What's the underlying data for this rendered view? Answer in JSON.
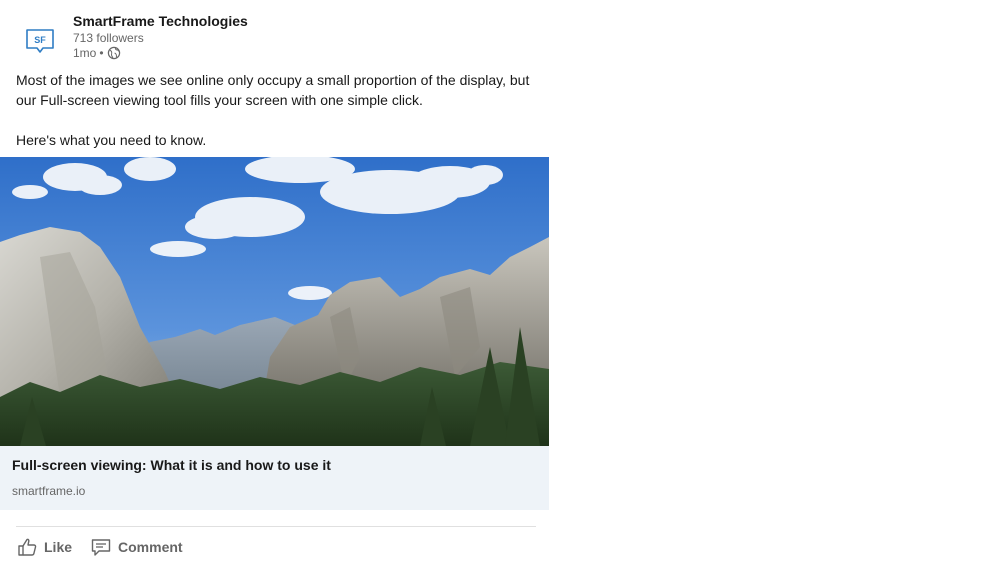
{
  "post": {
    "company": {
      "name": "SmartFrame Technologies",
      "logo_text": "SF",
      "followers": "713 followers"
    },
    "meta": {
      "time": "1mo",
      "separator": "•",
      "visibility_icon": "globe-icon"
    },
    "body": {
      "paragraph_1": "Most of the images we see online only occupy a small proportion of the display, but our Full-screen viewing tool fills your screen with one simple click.",
      "paragraph_2": "Here's what you need to know."
    },
    "image": {
      "subject": "mountain valley landscape with granite cliffs, forest and cloudy blue sky"
    },
    "link": {
      "title": "Full-screen viewing: What it is and how to use it",
      "domain": "smartframe.io"
    },
    "actions": [
      {
        "label": "Like",
        "icon": "thumbs-up-icon"
      },
      {
        "label": "Comment",
        "icon": "comment-icon"
      }
    ],
    "colors": {
      "logo_blue": "#2f7dc4",
      "link_card_bg": "#eef3f8",
      "secondary_text": "#666666"
    }
  }
}
